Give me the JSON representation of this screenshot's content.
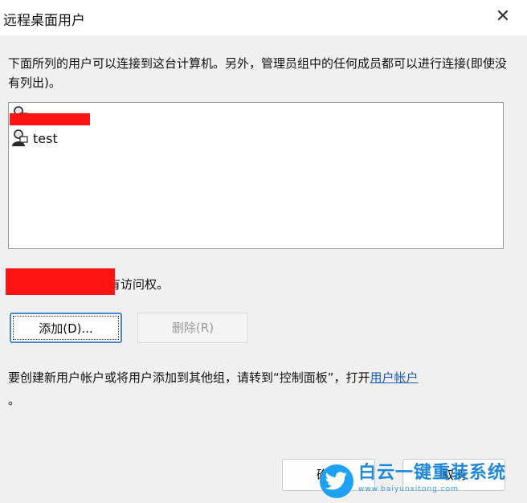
{
  "window": {
    "title": "远程桌面用户",
    "close_glyph": "✕"
  },
  "description": "下面所列的用户可以连接到这台计算机。另外，管理员组中的任何成员都可以进行连接(即使没有列出)。",
  "users": [
    {
      "name": "",
      "redacted": true,
      "icon": "user-icon"
    },
    {
      "name": "test",
      "redacted": false,
      "icon": "user-icon"
    }
  ],
  "access_text": "dministrator 已经有访问权。",
  "buttons": {
    "add": "添加(D)...",
    "remove": "删除(R)",
    "ok": "确定",
    "cancel": "取消"
  },
  "info": {
    "text": "要创建新用户帐户或将用户添加到其他组，请转到“控制面板”，打开",
    "link": "用户帐户",
    "trailing": "。"
  },
  "watermark": {
    "main": "白云一键重装系统",
    "url": "www.baiyunxitong.com"
  },
  "colors": {
    "redaction": "#ff1414",
    "link": "#1a5fb4",
    "focus_border": "#4a86c8"
  }
}
